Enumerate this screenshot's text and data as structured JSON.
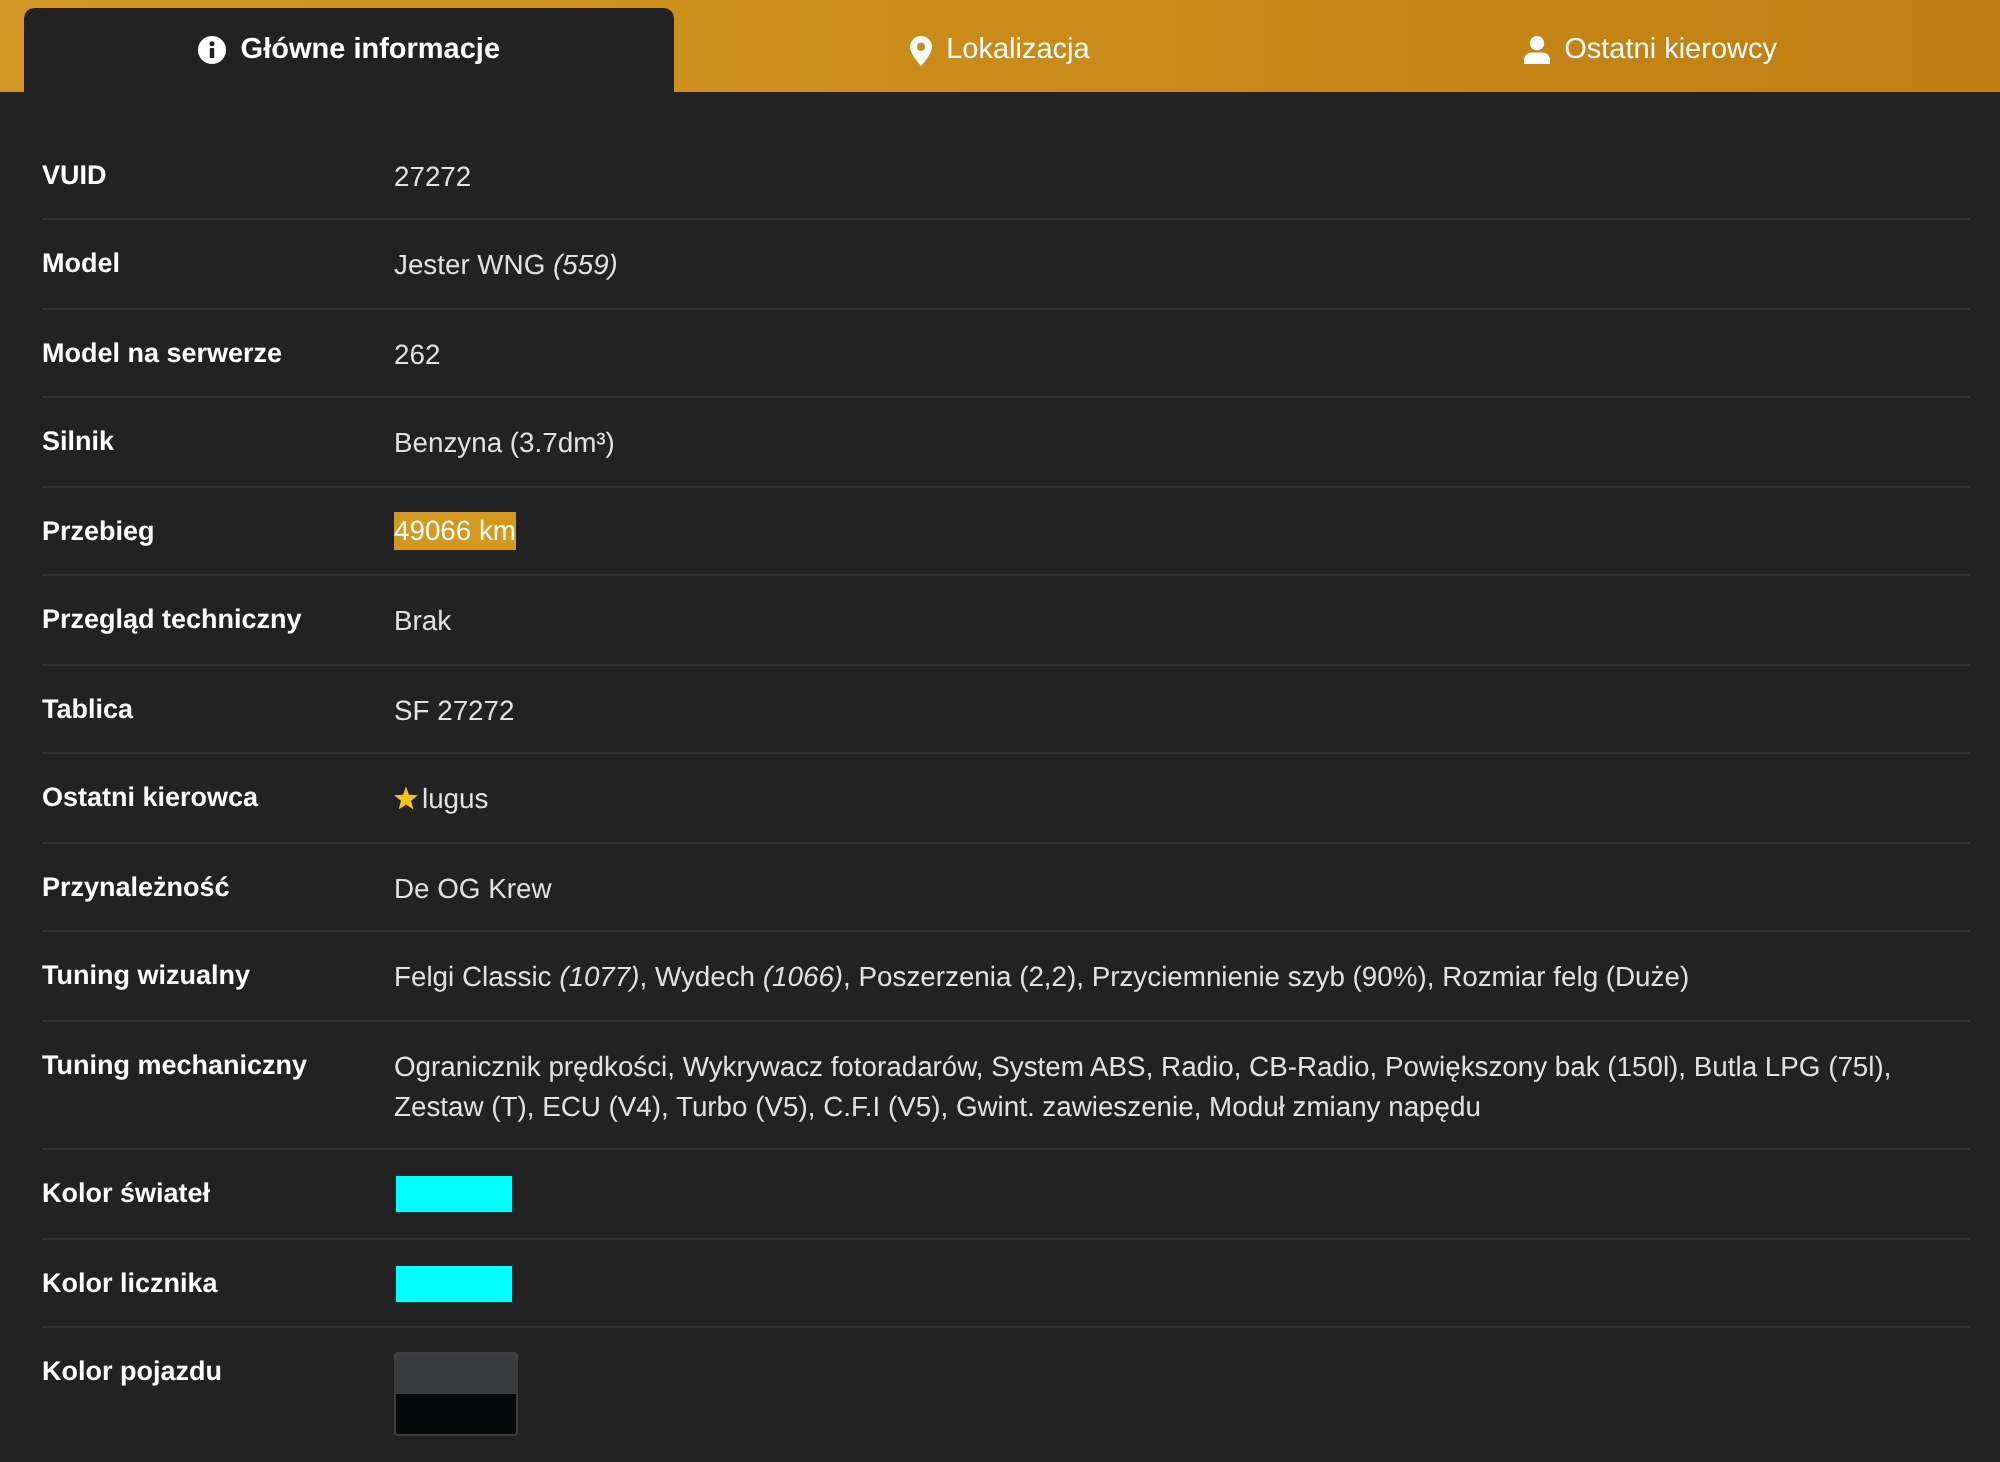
{
  "tabs": [
    {
      "label": "Główne informacje",
      "selected": true
    },
    {
      "label": "Lokalizacja",
      "selected": false
    },
    {
      "label": "Ostatni kierowcy",
      "selected": false
    }
  ],
  "rows": [
    {
      "label": "VUID",
      "kind": "text",
      "value": "27272"
    },
    {
      "label": "Model",
      "kind": "text",
      "value": "Jester WNG *(559)*"
    },
    {
      "label": "Model na serwerze",
      "kind": "text",
      "value": "262"
    },
    {
      "label": "Silnik",
      "kind": "text",
      "value": "Benzyna (3.7dm³)"
    },
    {
      "label": "Przebieg",
      "kind": "highlight",
      "value": "49066 km"
    },
    {
      "label": "Przegląd techniczny",
      "kind": "text",
      "value": "Brak"
    },
    {
      "label": "Tablica",
      "kind": "text",
      "value": "SF 27272"
    },
    {
      "label": "Ostatni kierowca",
      "kind": "driver",
      "value": "lugus",
      "starred": true
    },
    {
      "label": "Przynależność",
      "kind": "text",
      "value": "De OG Krew"
    },
    {
      "label": "Tuning wizualny",
      "kind": "text",
      "value": "Felgi Classic *(1077)*, Wydech *(1066)*, Poszerzenia (2,2), Przyciemnienie szyb (90%), Rozmiar felg (Duże)"
    },
    {
      "label": "Tuning mechaniczny",
      "kind": "text",
      "value": "Ogranicznik prędkości, Wykrywacz fotoradarów, System ABS, Radio, CB-Radio, Powiększony bak (150l), Butla LPG (75l), Zestaw (T), ECU (V4), Turbo (V5), C.F.I (V5), Gwint. zawieszenie, Moduł zmiany napędu"
    },
    {
      "label": "Kolor świateł",
      "kind": "swatch",
      "color": "#00ffff"
    },
    {
      "label": "Kolor licznika",
      "kind": "swatch",
      "color": "#00ffff"
    },
    {
      "label": "Kolor pojazdu",
      "kind": "dual_swatch",
      "swatches": [
        {
          "color": "#393b3f"
        },
        {
          "color": "#060909"
        }
      ]
    }
  ]
}
